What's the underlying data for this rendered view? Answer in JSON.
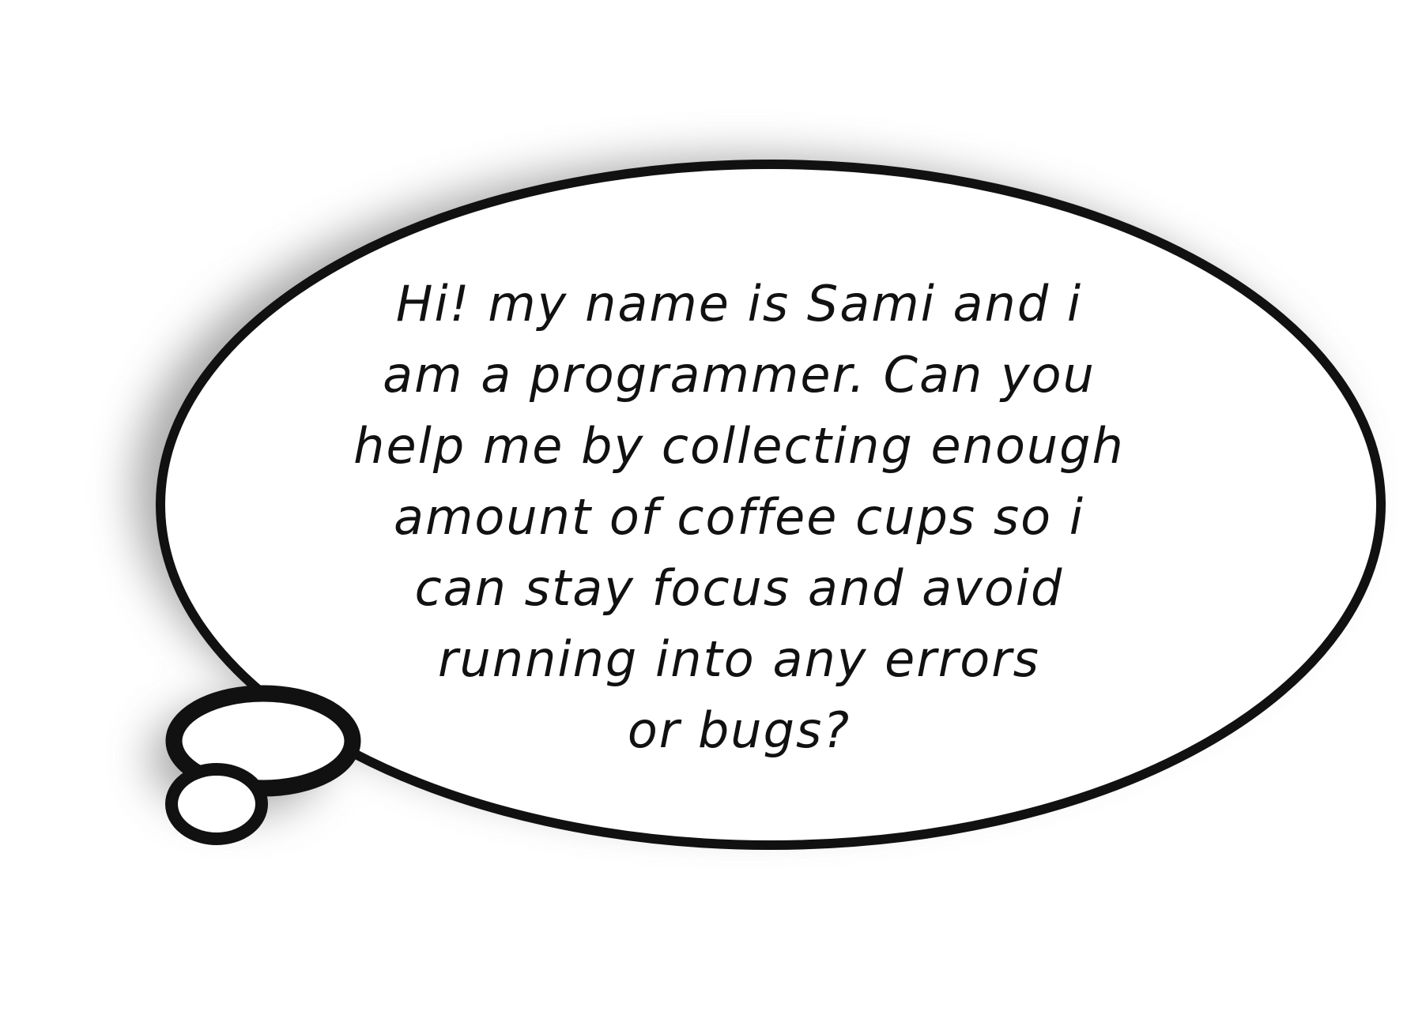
{
  "speech_bubble": {
    "lines": [
      "Hi! my name is Sami and i",
      "am a programmer. Can you",
      "help me by collecting enough",
      "amount of coffee cups so i",
      "can stay focus and avoid",
      "running into any errors",
      "or bugs?"
    ]
  },
  "colors": {
    "outline": "#111111",
    "fill": "#ffffff",
    "shadow": "#9a9a9a",
    "text": "#111111"
  }
}
